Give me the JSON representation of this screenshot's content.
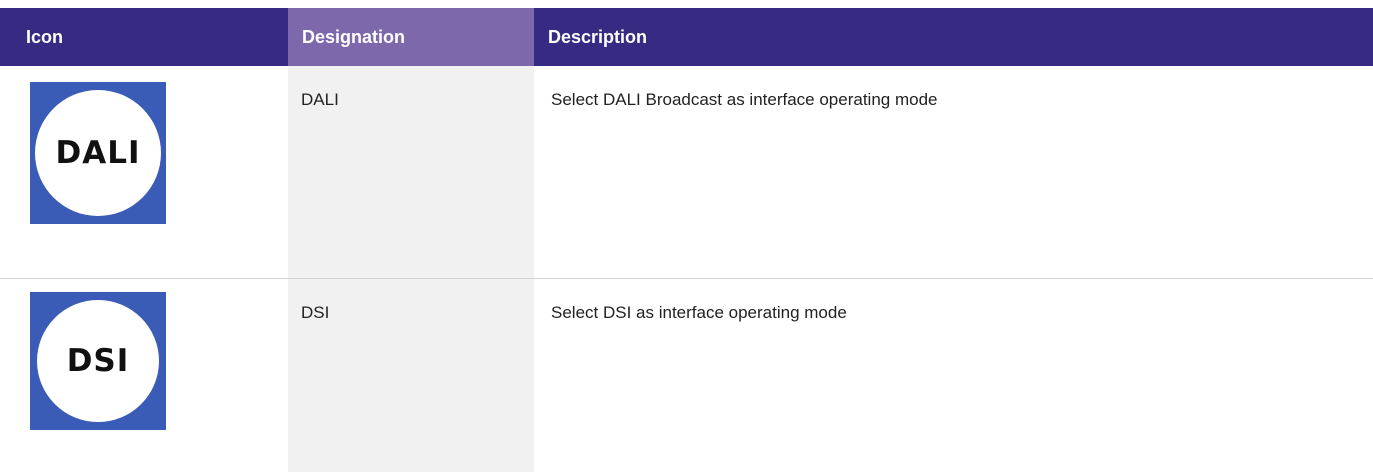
{
  "header": {
    "icon_label": "Icon",
    "designation_label": "Designation",
    "description_label": "Description"
  },
  "rows": [
    {
      "icon_text": "DALI",
      "icon_name": "dali-icon",
      "designation": "DALI",
      "description": "Select DALI Broadcast as interface operating mode"
    },
    {
      "icon_text": "DSI",
      "icon_name": "dsi-icon",
      "designation": "DSI",
      "description": "Select DSI as interface operating mode"
    }
  ],
  "colors": {
    "header_bg": "#362a82",
    "designation_header_bg": "#7d68ab",
    "designation_column_bg": "#f1f1f1",
    "icon_bg": "#3a5cb6"
  }
}
